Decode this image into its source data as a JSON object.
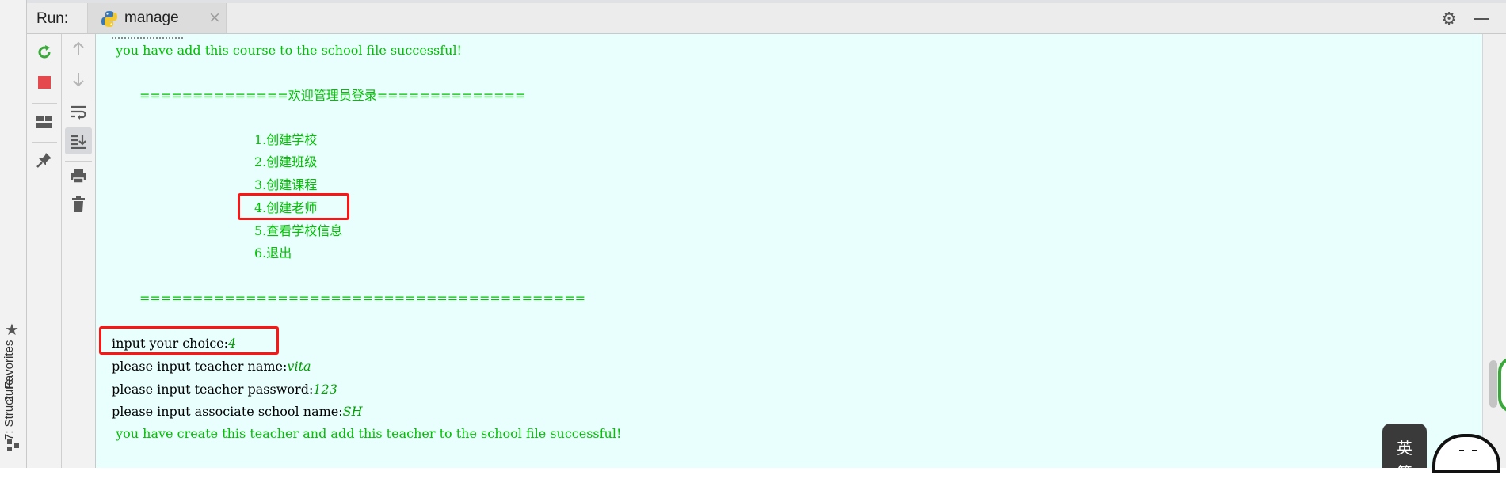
{
  "window": {
    "run_label": "Run:",
    "tab_label": "manage",
    "close_glyph": "×"
  },
  "side_tabs": {
    "favorites": "2: Favorites",
    "structure": "7: Structure"
  },
  "console": {
    "lines": {
      "course_success": " you have add this course to the school file successful!",
      "menu_header": "==============欢迎管理员登录==============",
      "opt1": "1.创建学校",
      "opt2": "2.创建班级",
      "opt3": "3.创建课程",
      "opt4": "4.创建老师",
      "opt5": "5.查看学校信息",
      "opt6": "6.退出",
      "menu_footer": "==========================================",
      "choice_prompt": "input your choice:",
      "choice_value": "4",
      "name_prompt": "please input teacher name:",
      "name_value": "vita",
      "password_prompt": "please input teacher password:",
      "password_value": "123",
      "school_prompt": "please input associate school name:",
      "school_value": "SH",
      "teacher_success": " you have create this teacher and add this teacher to the school file successful!"
    }
  },
  "ime": {
    "line1": "英",
    "line2": "简"
  },
  "colors": {
    "console_bg": "#e8fffd",
    "output_green": "#00c000",
    "input_green": "#00a000",
    "highlight_red": "#ff1414"
  },
  "icons": [
    "rerun-icon",
    "stop-icon",
    "layout-icon",
    "pin-icon",
    "up-arrow-icon",
    "down-arrow-icon",
    "soft-wrap-icon",
    "scroll-to-end-icon",
    "print-icon",
    "trash-icon",
    "gear-icon",
    "minimize-icon",
    "python-icon",
    "star-icon"
  ]
}
